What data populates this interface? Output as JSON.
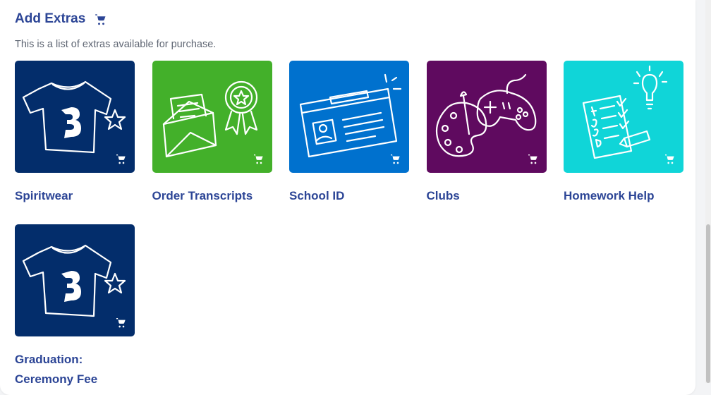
{
  "header": {
    "title": "Add Extras",
    "cart_icon": "shopping-cart-icon",
    "subtitle": "This is a list of extras available for purchase."
  },
  "colors": {
    "brand": "#2c4596",
    "spiritwear": "#032d6b",
    "transcripts": "#43b02a",
    "school_id": "#0071ce",
    "clubs": "#5f0a5f",
    "homework": "#10d5d8"
  },
  "extras": [
    {
      "label": "Spiritwear",
      "icon": "tshirt-star-icon"
    },
    {
      "label": "Order Transcripts",
      "icon": "envelope-ribbon-icon"
    },
    {
      "label": "School ID",
      "icon": "id-card-icon"
    },
    {
      "label": "Clubs",
      "icon": "palette-gamepad-icon"
    },
    {
      "label": "Homework Help",
      "icon": "checklist-lightbulb-icon"
    },
    {
      "label": "Graduation: Ceremony Fee",
      "icon": "tshirt-star-icon"
    }
  ]
}
